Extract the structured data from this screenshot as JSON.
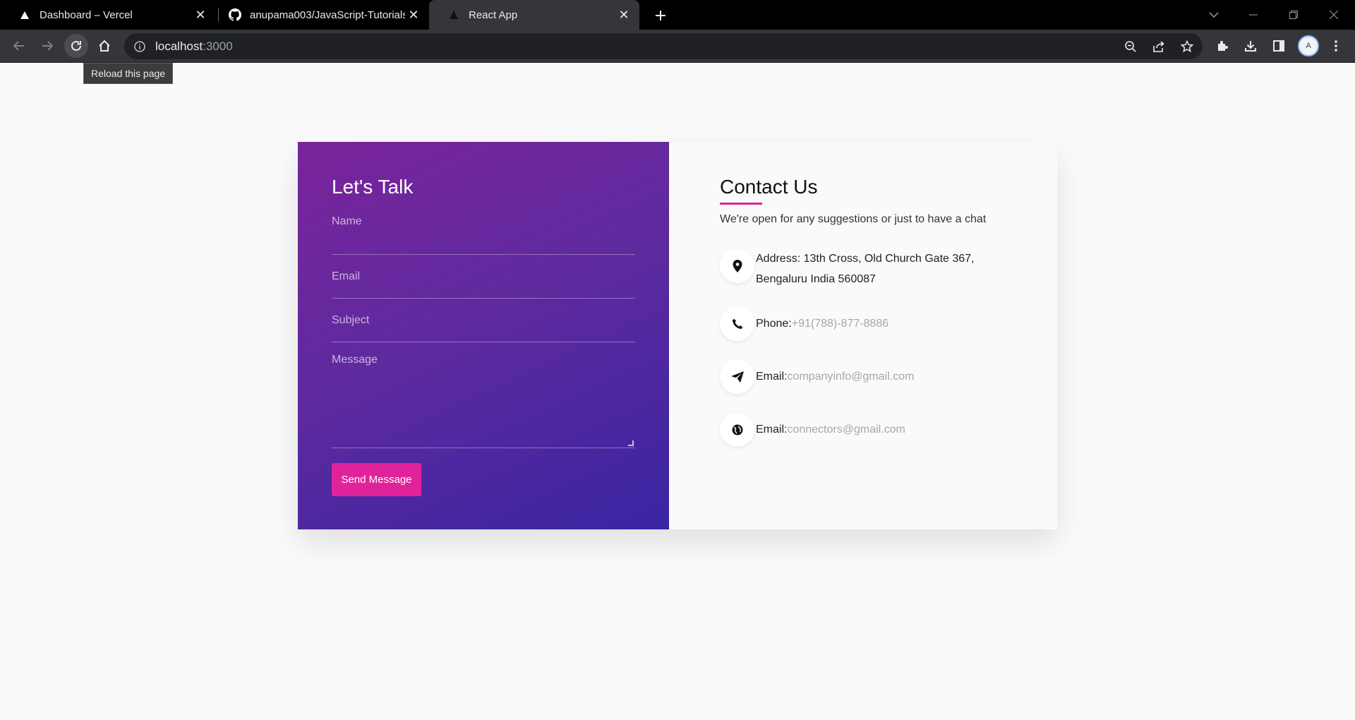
{
  "browser": {
    "tabs": [
      {
        "title": "Dashboard – Vercel",
        "icon": "vercel-triangle-icon"
      },
      {
        "title": "anupama003/JavaScript-Tutorials",
        "icon": "github-icon"
      },
      {
        "title": "React App",
        "icon": "react-app-icon"
      }
    ],
    "url_host": "localhost",
    "url_port": ":3000",
    "tooltip": "Reload this page",
    "avatar_letter": "A"
  },
  "form": {
    "title": "Let's Talk",
    "name_placeholder": "Name",
    "email_placeholder": "Email",
    "subject_placeholder": "Subject",
    "message_placeholder": "Message",
    "send_label": "Send Message"
  },
  "contact": {
    "title": "Contact Us",
    "subtitle": "We're open for any suggestions or just to have a chat",
    "address_label": "Address:",
    "address_line1": "13th Cross, Old Church Gate 367,",
    "address_line2": "Bengaluru India 560087",
    "phone_label": "Phone:",
    "phone_value": "+91(788)-877-8886",
    "email1_label": "Email:",
    "email1_value": "companyinfo@gmail.com",
    "email2_label": "Email:",
    "email2_value": "connectors@gmail.com"
  },
  "colors": {
    "accent": "#e0239a",
    "gradient_start": "#7a239c",
    "gradient_end": "#3a25a2"
  }
}
